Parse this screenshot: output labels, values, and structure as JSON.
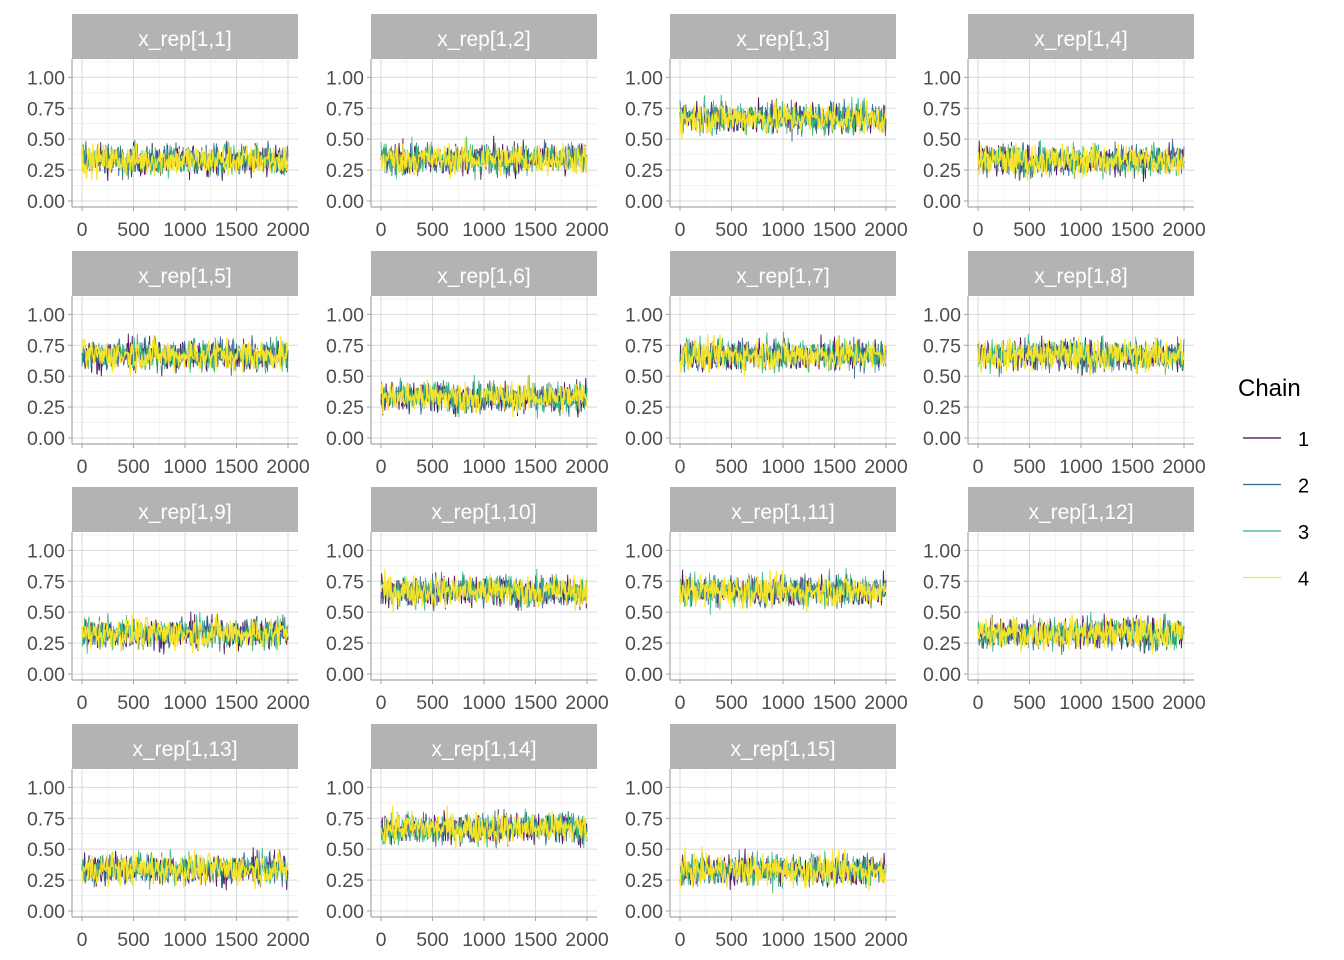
{
  "chart_data": {
    "type": "line",
    "kind": "MCMC trace plots (faceted)",
    "x_range": [
      0,
      2000
    ],
    "x_ticks": [
      0,
      500,
      1000,
      1500,
      2000
    ],
    "x_tick_labels": [
      "0",
      "500",
      "1000",
      "1500",
      "2000"
    ],
    "y_range": [
      0,
      1.1
    ],
    "y_ticks": [
      0,
      0.25,
      0.5,
      0.75,
      1.0
    ],
    "y_tick_labels": [
      "0.00",
      "0.25",
      "0.50",
      "0.75",
      "1.00"
    ],
    "grid": true,
    "legend": {
      "title": "Chain",
      "position": "right",
      "entries": [
        {
          "label": "1",
          "color": "#440154"
        },
        {
          "label": "2",
          "color": "#31688e"
        },
        {
          "label": "3",
          "color": "#35b779"
        },
        {
          "label": "4",
          "color": "#fde725"
        }
      ]
    },
    "chain_colors": [
      "#440154",
      "#31688e",
      "#35b779",
      "#fde725"
    ],
    "panels": [
      {
        "title": "x_rep[1,1]",
        "center": 0.33,
        "spread": 0.2
      },
      {
        "title": "x_rep[1,2]",
        "center": 0.34,
        "spread": 0.2
      },
      {
        "title": "x_rep[1,3]",
        "center": 0.67,
        "spread": 0.2
      },
      {
        "title": "x_rep[1,4]",
        "center": 0.33,
        "spread": 0.2
      },
      {
        "title": "x_rep[1,5]",
        "center": 0.67,
        "spread": 0.2
      },
      {
        "title": "x_rep[1,6]",
        "center": 0.33,
        "spread": 0.2
      },
      {
        "title": "x_rep[1,7]",
        "center": 0.67,
        "spread": 0.2
      },
      {
        "title": "x_rep[1,8]",
        "center": 0.67,
        "spread": 0.2
      },
      {
        "title": "x_rep[1,9]",
        "center": 0.33,
        "spread": 0.2
      },
      {
        "title": "x_rep[1,10]",
        "center": 0.67,
        "spread": 0.2
      },
      {
        "title": "x_rep[1,11]",
        "center": 0.67,
        "spread": 0.2
      },
      {
        "title": "x_rep[1,12]",
        "center": 0.33,
        "spread": 0.2
      },
      {
        "title": "x_rep[1,13]",
        "center": 0.34,
        "spread": 0.2
      },
      {
        "title": "x_rep[1,14]",
        "center": 0.67,
        "spread": 0.2
      },
      {
        "title": "x_rep[1,15]",
        "center": 0.33,
        "spread": 0.2
      }
    ]
  }
}
